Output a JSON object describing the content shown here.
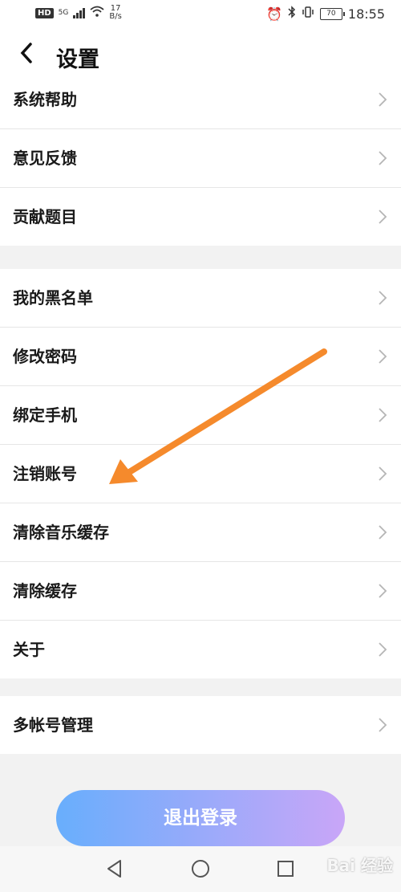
{
  "status_bar": {
    "hd": "HD",
    "network": "5G",
    "speed_value": "17",
    "speed_unit": "B/s",
    "battery": "70",
    "time": "18:55"
  },
  "header": {
    "title": "设置"
  },
  "groups": [
    {
      "items": [
        {
          "label": "系统帮助"
        },
        {
          "label": "意见反馈"
        },
        {
          "label": "贡献题目"
        }
      ]
    },
    {
      "items": [
        {
          "label": "我的黑名单"
        },
        {
          "label": "修改密码"
        },
        {
          "label": "绑定手机"
        },
        {
          "label": "注销账号"
        },
        {
          "label": "清除音乐缓存"
        },
        {
          "label": "清除缓存"
        },
        {
          "label": "关于"
        }
      ]
    },
    {
      "items": [
        {
          "label": "多帐号管理"
        }
      ]
    }
  ],
  "logout_label": "退出登录",
  "watermark": "Bai 经验",
  "colors": {
    "arrow": "#f58a2c",
    "button_start": "#68aefc",
    "button_end": "#c9a6f8"
  }
}
